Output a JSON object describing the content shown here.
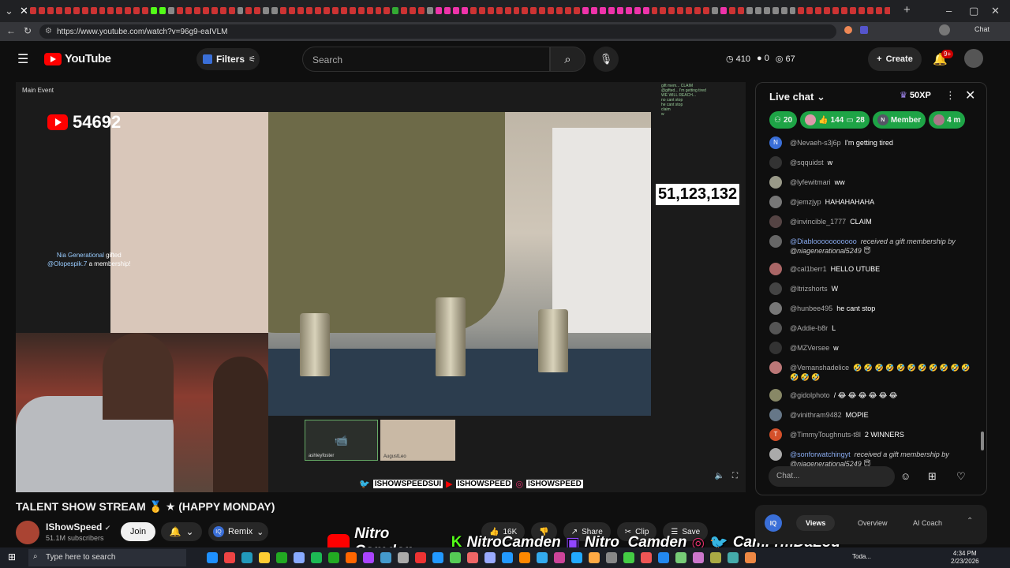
{
  "browser": {
    "url": "https://www.youtube.com/watch?v=96g9-eaIVLM"
  },
  "header": {
    "logo_text": "YouTube",
    "filters_label": "Filters",
    "search_placeholder": "Search",
    "stat_views": "410",
    "stat_zero": "0",
    "stat_67": "67",
    "create_label": "Create",
    "notif_badge": "9+"
  },
  "video": {
    "main_event_label": "Main Event",
    "yt_counter": "54692",
    "sub_counter": "51,123,132",
    "gift_note_line1": "Nia Generational",
    "gift_note_word": "gifted",
    "gift_note_line2": "@Olopespik.7",
    "gift_note_line3": "a membership!",
    "call_name_1": "ashleyfoster",
    "call_name_2": "AugustLeo",
    "social_handles": [
      "ISHOWSPEEDSUI",
      "ISHOWSPEED",
      "ISHOWSPEED"
    ]
  },
  "meta": {
    "title": "TALENT SHOW STREAM 🥇 ★ (HAPPY MONDAY)",
    "channel_name": "IShowSpeed",
    "subscribers": "51.1M subscribers",
    "join_label": "Join",
    "remix_label": "Remix",
    "like_count": "16K",
    "share_label": "Share",
    "clip_label": "Clip",
    "save_label": "Save"
  },
  "promo": {
    "yt_name": "Nitro Camden",
    "kick_name": "NitroCamden",
    "twitch_name": "Nitro_Camden",
    "ig_tw_name": "CamFrmDaLou"
  },
  "chat": {
    "title": "Live chat",
    "xp_label": "50XP",
    "pill_count_1": "20",
    "pill_count_2": "144",
    "pill_count_3": "28",
    "member_label": "Member",
    "pill_last": "4 m",
    "input_placeholder": "Chat...",
    "messages": [
      {
        "author": "@Nevaeh-s3j6p",
        "text": "I'm getting tired",
        "gift": false,
        "initial": "N",
        "color": "#3a6fd8"
      },
      {
        "author": "@sqquidst",
        "text": "w",
        "gift": false,
        "initial": "",
        "color": "#333"
      },
      {
        "author": "@lyfewitmari",
        "text": "ww",
        "gift": false,
        "initial": "",
        "color": "#998"
      },
      {
        "author": "@jemzjyp",
        "text": "HAHAHAHAHA",
        "gift": false,
        "initial": "",
        "color": "#777"
      },
      {
        "author": "@invincible_1777",
        "text": "CLAIM",
        "gift": false,
        "initial": "",
        "color": "#544"
      },
      {
        "author": "@Diablooooooooooo",
        "text": "received a gift membership by @niagenerational5249 😇",
        "gift": true,
        "initial": "",
        "color": "#666"
      },
      {
        "author": "@cal1berr1",
        "text": "HELLO UTUBE",
        "gift": false,
        "initial": "",
        "color": "#a66"
      },
      {
        "author": "@ltrizshorts",
        "text": "W",
        "gift": false,
        "initial": "",
        "color": "#444"
      },
      {
        "author": "@hunbee495",
        "text": "he cant stop",
        "gift": false,
        "initial": "",
        "color": "#777"
      },
      {
        "author": "@Addie-b8r",
        "text": "L",
        "gift": false,
        "initial": "",
        "color": "#555"
      },
      {
        "author": "@MZVersee",
        "text": "w",
        "gift": false,
        "initial": "",
        "color": "#333"
      },
      {
        "author": "@Vemanshadelice",
        "text": "🤣 🤣 🤣 🤣 🤣 🤣 🤣 🤣 🤣 🤣 🤣 🤣 🤣 🤣",
        "gift": false,
        "initial": "",
        "color": "#b77"
      },
      {
        "author": "@gidolphoto",
        "text": "/ 😂 😂 😂 😂 😂 😂",
        "gift": false,
        "initial": "",
        "color": "#886"
      },
      {
        "author": "@vinithram9482",
        "text": "MOPIE",
        "gift": false,
        "initial": "",
        "color": "#678"
      },
      {
        "author": "@TimmyToughnuts-t8l",
        "text": "2 WINNERS",
        "gift": false,
        "initial": "T",
        "color": "#d4502a"
      },
      {
        "author": "@sonforwatchingyt",
        "text": "received a gift membership by @niagenerational5249 😇",
        "gift": true,
        "initial": "",
        "color": "#aaa"
      }
    ]
  },
  "bottom_panel": {
    "iq_label": "IQ",
    "tab_views": "Views",
    "tab_overview": "Overview",
    "tab_coach": "AI Coach"
  },
  "taskbar": {
    "search_placeholder": "Type here to search",
    "weather": "Toda...",
    "time": "4:34 PM",
    "date": "2/23/2026"
  },
  "colors": {
    "yt_red": "#ff0000",
    "chat_accent": "#1ea446",
    "bg": "#0f0f0f"
  }
}
